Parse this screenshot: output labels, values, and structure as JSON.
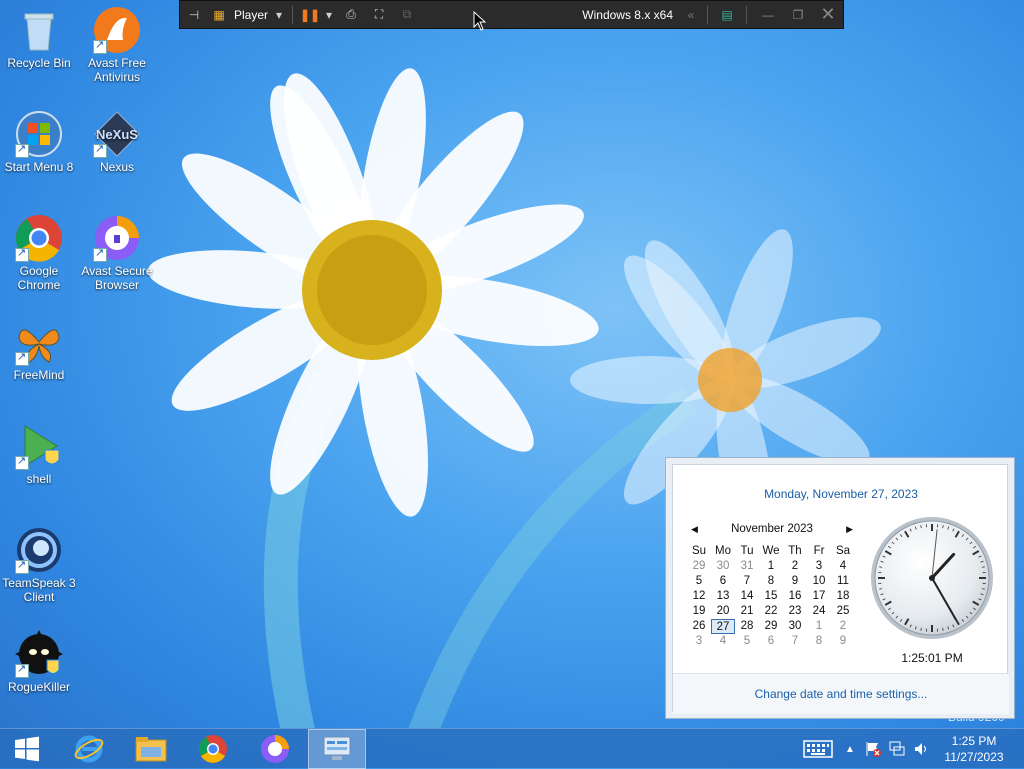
{
  "desktop": {
    "icons": [
      {
        "label": "Recycle Bin"
      },
      {
        "label": "Avast Free Antivirus"
      },
      {
        "label": "Start Menu 8"
      },
      {
        "label": "Nexus"
      },
      {
        "label": "Google Chrome"
      },
      {
        "label": "Avast Secure Browser"
      },
      {
        "label": "FreeMind"
      },
      {
        "label": "shell"
      },
      {
        "label": "TeamSpeak 3 Client"
      },
      {
        "label": "RogueKiller"
      }
    ],
    "nexus_logo_text": "NeXuS",
    "build_watermark": "Build 9200"
  },
  "vm_toolbar": {
    "player_label": "Player",
    "vm_name": "Windows 8.x x64"
  },
  "clock_popup": {
    "long_date": "Monday, November 27, 2023",
    "month_title": "November 2023",
    "weekday_headers": [
      "Su",
      "Mo",
      "Tu",
      "We",
      "Th",
      "Fr",
      "Sa"
    ],
    "weeks": [
      [
        "29",
        "30",
        "31",
        "1",
        "2",
        "3",
        "4"
      ],
      [
        "5",
        "6",
        "7",
        "8",
        "9",
        "10",
        "11"
      ],
      [
        "12",
        "13",
        "14",
        "15",
        "16",
        "17",
        "18"
      ],
      [
        "19",
        "20",
        "21",
        "22",
        "23",
        "24",
        "25"
      ],
      [
        "26",
        "27",
        "28",
        "29",
        "30",
        "1",
        "2"
      ],
      [
        "3",
        "4",
        "5",
        "6",
        "7",
        "8",
        "9"
      ]
    ],
    "selected_day": "27",
    "time_long": "1:25:01 PM",
    "settings_link": "Change date and time settings..."
  },
  "taskbar": {
    "time": "1:25 PM",
    "date": "11/27/2023",
    "apps": [
      "start-button",
      "internet-explorer",
      "file-explorer",
      "google-chrome",
      "avast-secure-browser",
      "control-panel"
    ]
  },
  "colors": {
    "link_blue": "#1c5fa8",
    "taskbar_blue": "#286ebe",
    "vm_toolbar_bg": "#2b2b2b"
  }
}
